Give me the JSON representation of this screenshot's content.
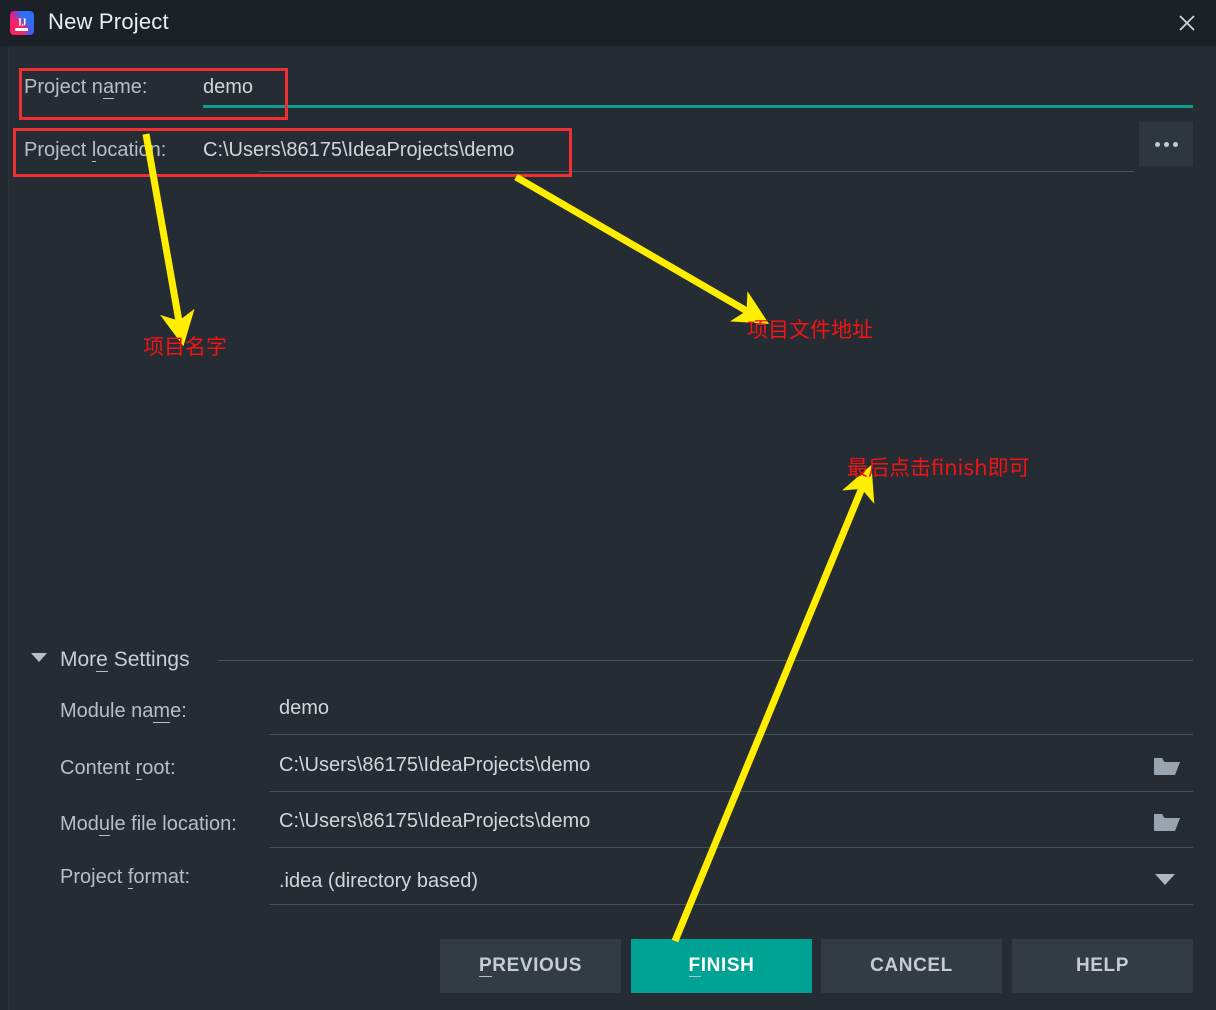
{
  "window": {
    "title": "New Project",
    "app_icon": "intellij-idea-icon",
    "close_icon": "close-icon"
  },
  "form": {
    "project_name": {
      "label": "Project name:",
      "label_mnemonic": "a",
      "value": "demo"
    },
    "project_location": {
      "label": "Project location:",
      "label_mnemonic": "l",
      "value": "C:\\Users\\86175\\IdeaProjects\\demo",
      "browse_icon": "ellipsis-icon"
    }
  },
  "more_settings": {
    "label": "More Settings",
    "label_mnemonic": "e",
    "expanded": true,
    "toggle_icon": "chevron-down-icon",
    "rows": [
      {
        "label": "Module name:",
        "label_mnemonic": "m",
        "value": "demo",
        "trailing_icon": null
      },
      {
        "label": "Content root:",
        "label_mnemonic": "r",
        "value": "C:\\Users\\86175\\IdeaProjects\\demo",
        "trailing_icon": "folder-icon"
      },
      {
        "label": "Module file location:",
        "label_mnemonic": "u",
        "value": "C:\\Users\\86175\\IdeaProjects\\demo",
        "trailing_icon": "folder-icon"
      },
      {
        "label": "Project format:",
        "label_mnemonic": "f",
        "value": ".idea (directory based)",
        "trailing_icon": "chevron-down-icon"
      }
    ]
  },
  "buttons": {
    "previous": "PREVIOUS",
    "finish": "FINISH",
    "cancel": "CANCEL",
    "help": "HELP"
  },
  "annotations": {
    "project_name_note": "项目名字",
    "project_location_note": "项目文件地址",
    "finish_note": "最后点击finish即可"
  },
  "colors": {
    "background": "#262c33",
    "titlebar": "#1b2126",
    "accent_teal": "#00a294",
    "focus_underline": "#0f9e8e",
    "annotation_red": "#f21414",
    "annotation_box": "#f03030",
    "annotation_arrow": "#ffee00",
    "text_primary": "#cfd6dc",
    "text_label": "#b6bfc7"
  }
}
